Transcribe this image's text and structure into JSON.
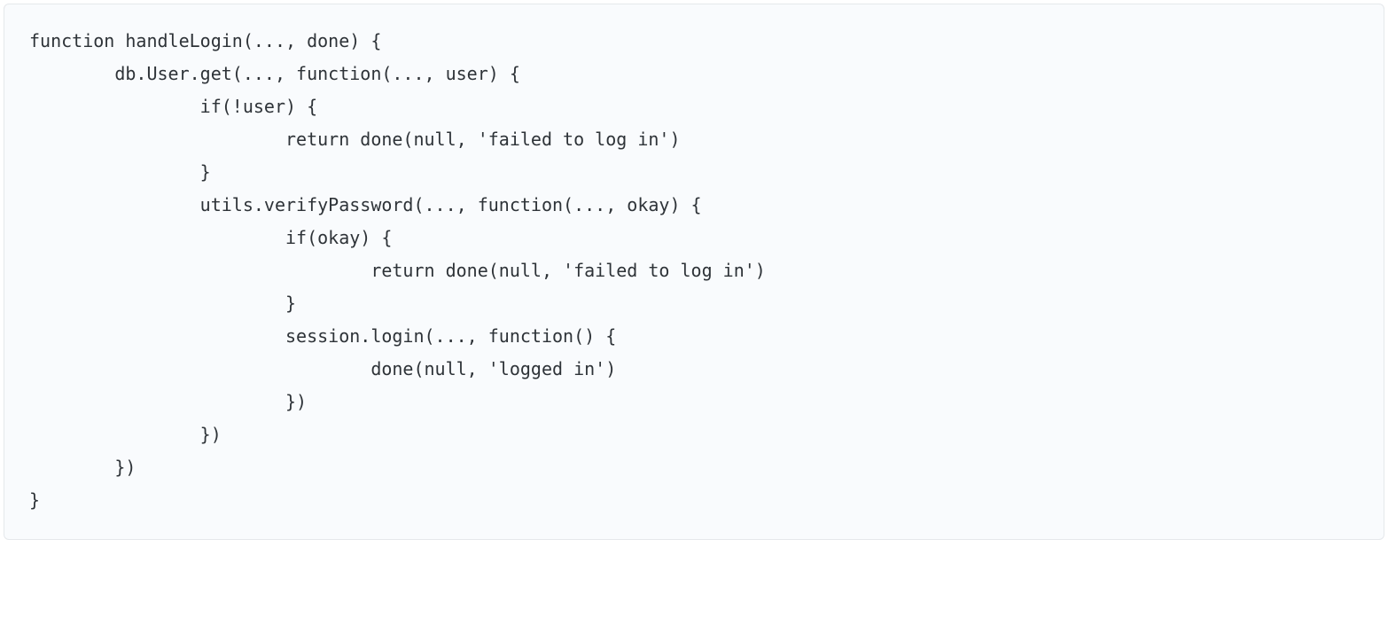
{
  "code": {
    "lines": [
      "function handleLogin(..., done) {",
      "        db.User.get(..., function(..., user) {",
      "                if(!user) {",
      "                        return done(null, 'failed to log in')",
      "                }",
      "                utils.verifyPassword(..., function(..., okay) {",
      "                        if(okay) {",
      "                                return done(null, 'failed to log in')",
      "                        }",
      "                        session.login(..., function() {",
      "                                done(null, 'logged in')",
      "                        })",
      "                })",
      "        })",
      "}"
    ]
  }
}
